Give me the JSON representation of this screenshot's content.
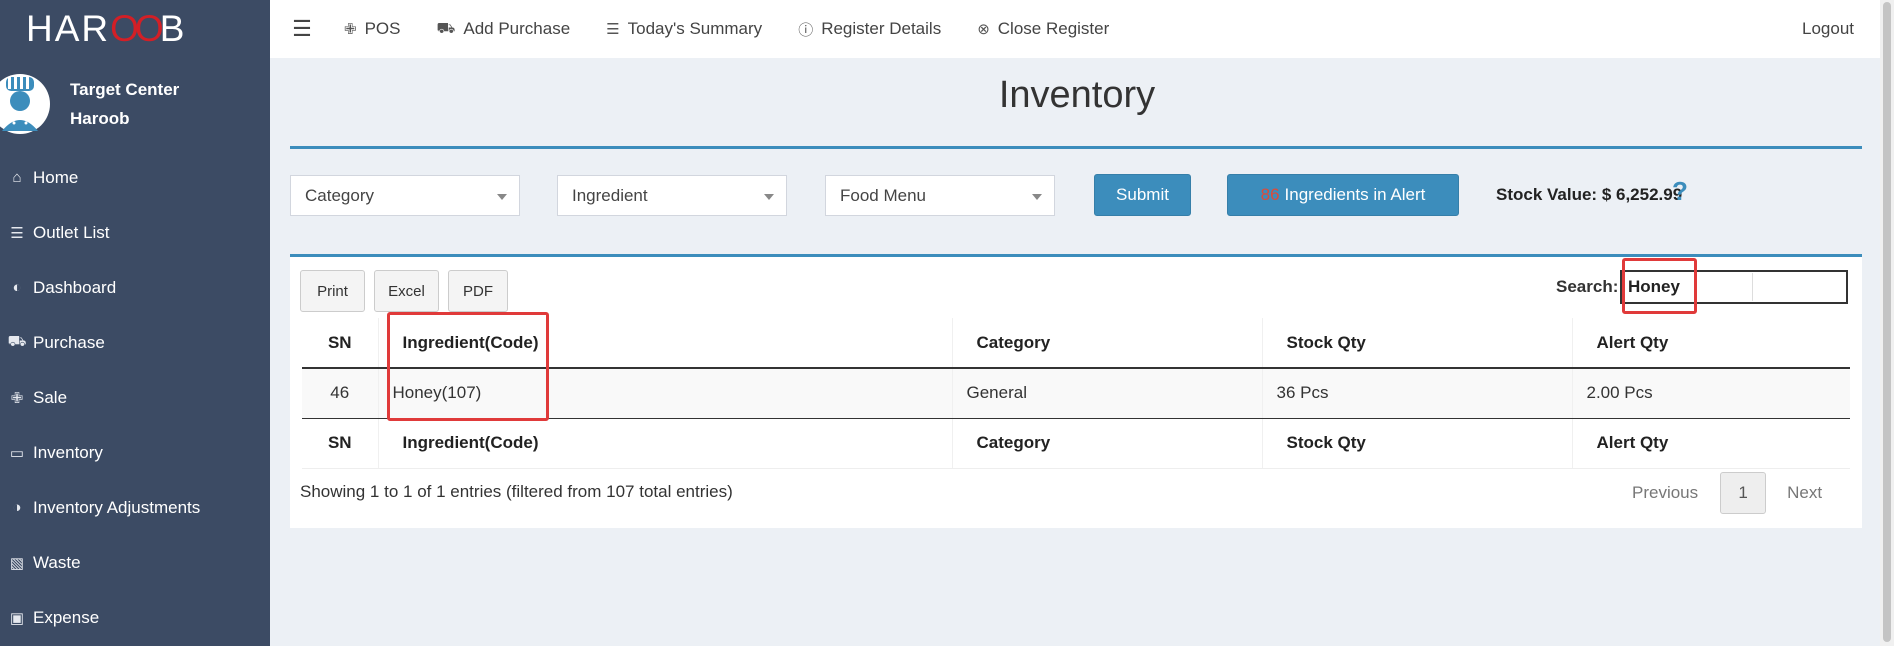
{
  "brand": {
    "logo_pre": "HAR",
    "logo_mid": "OO",
    "logo_post": "B"
  },
  "user": {
    "outlet": "Target Center",
    "name": "Haroob"
  },
  "sidebar": {
    "items": [
      {
        "label": "Home",
        "icon": "home-icon"
      },
      {
        "label": "Outlet List",
        "icon": "list-icon"
      },
      {
        "label": "Dashboard",
        "icon": "dashboard-icon"
      },
      {
        "label": "Purchase",
        "icon": "truck-icon"
      },
      {
        "label": "Sale",
        "icon": "cutlery-icon"
      },
      {
        "label": "Inventory",
        "icon": "inbox-icon"
      },
      {
        "label": "Inventory Adjustments",
        "icon": "adjust-icon"
      },
      {
        "label": "Waste",
        "icon": "trash-icon"
      },
      {
        "label": "Expense",
        "icon": "money-icon"
      }
    ]
  },
  "topbar": {
    "nav": [
      {
        "label": "POS",
        "icon": "cutlery-icon"
      },
      {
        "label": "Add Purchase",
        "icon": "truck-icon"
      },
      {
        "label": "Today's Summary",
        "icon": "list-icon"
      },
      {
        "label": "Register Details",
        "icon": "info-circle-icon"
      },
      {
        "label": "Close Register",
        "icon": "close-circle-icon"
      }
    ],
    "logout": "Logout"
  },
  "page": {
    "title": "Inventory"
  },
  "filters": {
    "category": "Category",
    "ingredient": "Ingredient",
    "food_menu": "Food Menu",
    "submit": "Submit",
    "alert_count": "86",
    "alert_label": "Ingredients in Alert",
    "stock_value": "Stock Value: $ 6,252.99",
    "help": "?"
  },
  "table_tools": {
    "buttons": [
      "Print",
      "Excel",
      "PDF"
    ],
    "search_label": "Search:",
    "search_value": "Honey"
  },
  "table": {
    "columns": [
      "SN",
      "Ingredient(Code)",
      "Category",
      "Stock Qty",
      "Alert Qty"
    ],
    "rows": [
      {
        "sn": "46",
        "ingredient": "Honey(107)",
        "category": "General",
        "stock": "36 Pcs",
        "alert": "2.00 Pcs"
      }
    ]
  },
  "footer": {
    "info": "Showing 1 to 1 of 1 entries (filtered from 107 total entries)",
    "previous": "Previous",
    "page": "1",
    "next": "Next"
  },
  "colors": {
    "sidebar": "#3c4b64",
    "primary": "#3c8dbc",
    "highlight": "#e03a3a",
    "alert_number": "#dd4b39"
  }
}
